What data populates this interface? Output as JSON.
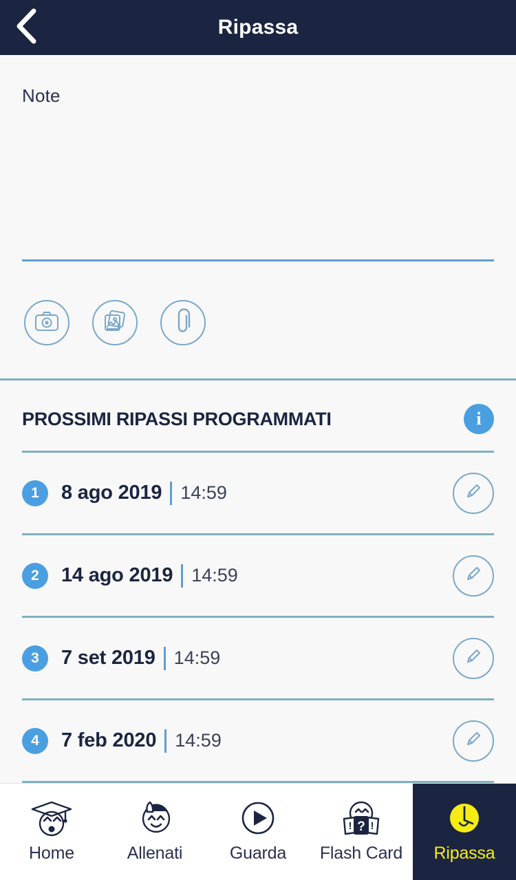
{
  "header": {
    "title": "Ripassa",
    "back_icon": "chevron-left-icon",
    "bg_color": "#1b2541"
  },
  "note": {
    "placeholder": "Note",
    "value": "",
    "attachments": [
      {
        "name": "camera-icon",
        "label": "camera"
      },
      {
        "name": "gallery-icon",
        "label": "gallery"
      },
      {
        "name": "paperclip-icon",
        "label": "attachment"
      }
    ]
  },
  "schedule": {
    "title": "PROSSIMI RIPASSI PROGRAMMATI",
    "info_icon": "info-icon",
    "info_label": "i",
    "accent_color": "#4a9fe0",
    "rows": [
      {
        "index": "1",
        "date": "8 ago 2019",
        "time": "14:59",
        "edit_icon": "pencil-icon"
      },
      {
        "index": "2",
        "date": "14 ago 2019",
        "time": "14:59",
        "edit_icon": "pencil-icon"
      },
      {
        "index": "3",
        "date": "7 set 2019",
        "time": "14:59",
        "edit_icon": "pencil-icon"
      },
      {
        "index": "4",
        "date": "7 feb 2020",
        "time": "14:59",
        "edit_icon": "pencil-icon"
      }
    ]
  },
  "nav": {
    "active_color": "#f5ec16",
    "active_bg": "#1b2541",
    "items": [
      {
        "label": "Home",
        "icon": "graduate-face-icon",
        "active": false
      },
      {
        "label": "Allenati",
        "icon": "sweating-face-icon",
        "active": false
      },
      {
        "label": "Guarda",
        "icon": "play-circle-icon",
        "active": false
      },
      {
        "label": "Flash Card",
        "icon": "flashcard-face-icon",
        "active": false
      },
      {
        "label": "Ripassa",
        "icon": "clock-icon",
        "active": true
      }
    ]
  }
}
